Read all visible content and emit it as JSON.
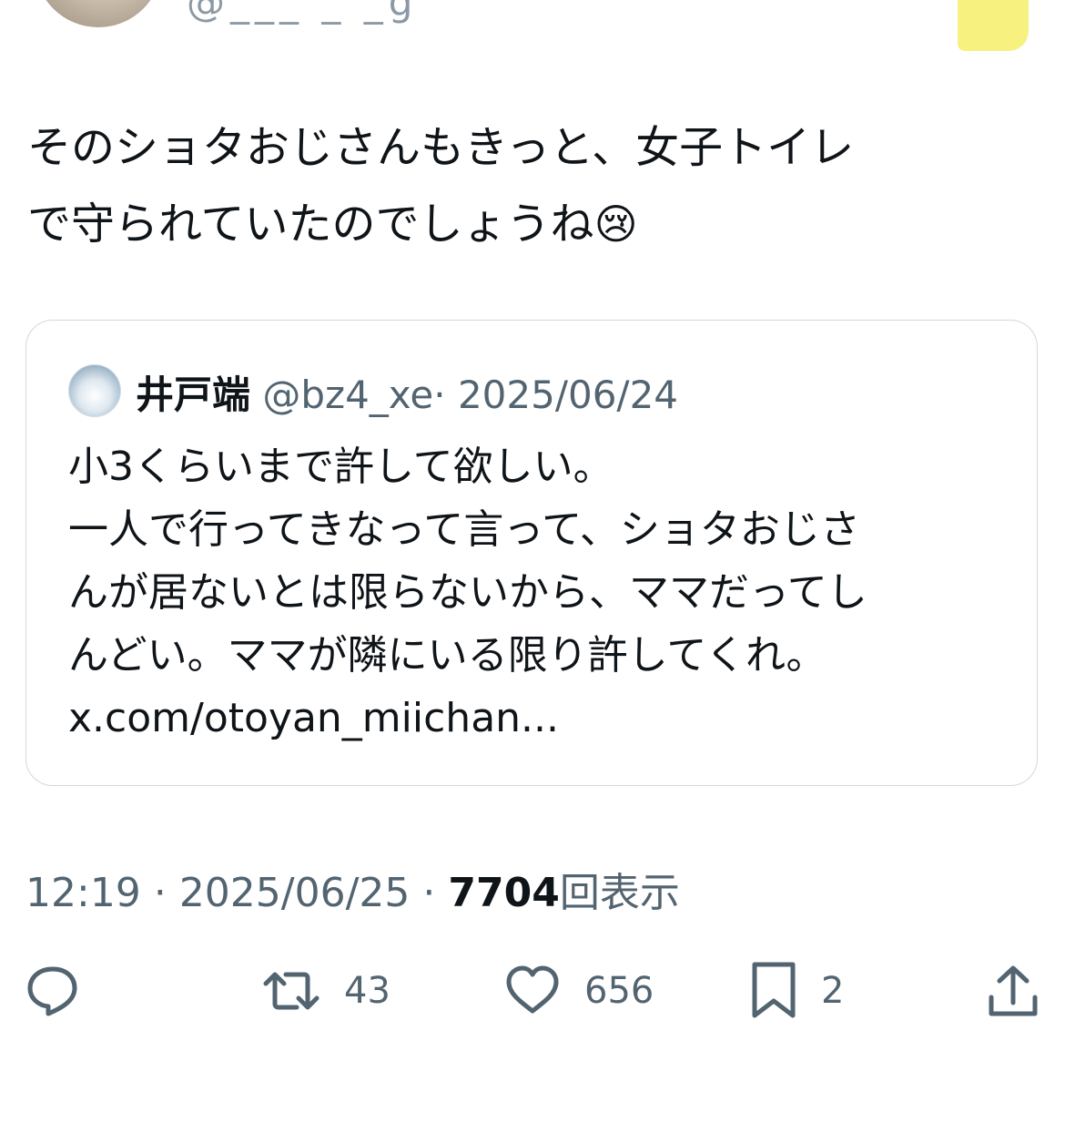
{
  "author": {
    "handle_partial": "@___ _ _g"
  },
  "tweet": {
    "text_line1": "そのショタおじさんもきっと、女子トイレ",
    "text_line2": "で守られていたのでしょうね",
    "emoji": "😢"
  },
  "quote": {
    "name": "井戸端",
    "handle": "@bz4_xe",
    "separator": "·",
    "date": "2025/06/24",
    "lines": [
      "小3くらいまで許して欲しい。",
      "一人で行ってきなって言って、ショタおじさ",
      "んが居ないとは限らないから、ママだってし",
      "んどい。ママが隣にいる限り許してくれ。",
      "x.com/otoyan_miichan..."
    ]
  },
  "timestamp": {
    "time": "12:19",
    "sep1": "·",
    "date": "2025/06/25",
    "sep2": "·",
    "views_count": "7704",
    "views_label": "回表示"
  },
  "actions": {
    "reply_icon": "speech-bubble-icon",
    "retweet_icon": "retweet-icon",
    "retweet_count": "43",
    "like_icon": "heart-icon",
    "like_count": "656",
    "bookmark_icon": "bookmark-icon",
    "bookmark_count": "2",
    "share_icon": "share-icon"
  },
  "colors": {
    "text": "#0f1419",
    "secondary": "#536471",
    "border": "#cfd9de"
  }
}
